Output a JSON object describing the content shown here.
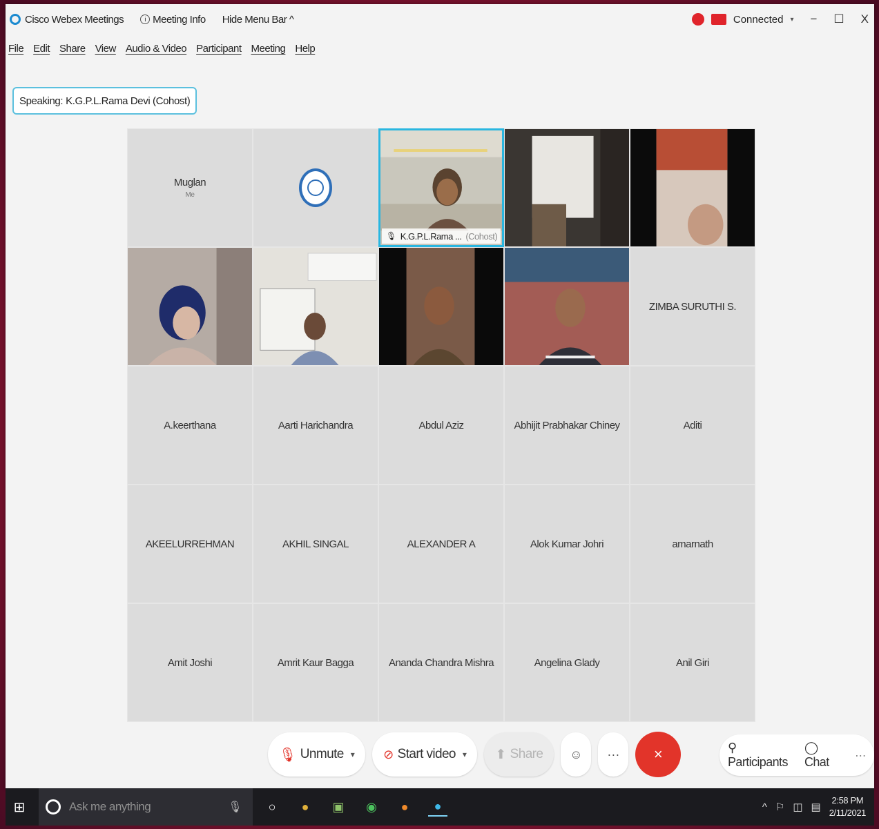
{
  "titlebar": {
    "app_name": "Cisco Webex Meetings",
    "meeting_info": "Meeting Info",
    "hide_menu": "Hide Menu Bar ^",
    "connection": "Connected",
    "minimize": "−",
    "maximize": "☐",
    "close": "X"
  },
  "menu": [
    "File",
    "Edit",
    "Share",
    "View",
    "Audio & Video",
    "Participant",
    "Meeting",
    "Help"
  ],
  "speaking": {
    "label": "Speaking:",
    "name": "K.G.P.L.Rama Devi (Cohost)"
  },
  "tiles": {
    "t0": {
      "name": "Muglan",
      "sub": "Me"
    },
    "t2": {
      "name": "K.G.P.L.Rama ...",
      "role": "(Cohost)"
    },
    "t9": {
      "name": "ZIMBA SURUTHI S."
    },
    "row3": [
      "A.keerthana",
      "Aarti Harichandra",
      "Abdul Aziz",
      "Abhijit Prabhakar Chiney",
      "Aditi"
    ],
    "row4": [
      "AKEELURREHMAN",
      "AKHIL SINGAL",
      "ALEXANDER A",
      "Alok Kumar Johri",
      "amarnath"
    ],
    "row5": [
      "Amit Joshi",
      "Amrit Kaur Bagga",
      "Ananda Chandra Mishra",
      "Angelina Glady",
      "Anil Giri"
    ]
  },
  "controls": {
    "unmute": "Unmute",
    "start_video": "Start video",
    "share": "Share",
    "more": "···",
    "end": "×",
    "participants": "Participants",
    "chat": "Chat",
    "overflow": "···"
  },
  "taskbar": {
    "search_placeholder": "Ask me anything",
    "time": "2:58 PM",
    "date": "2/11/2021"
  },
  "colors": {
    "accent": "#29b6e0",
    "end_call": "#e2342a",
    "background": "#8a1430"
  }
}
